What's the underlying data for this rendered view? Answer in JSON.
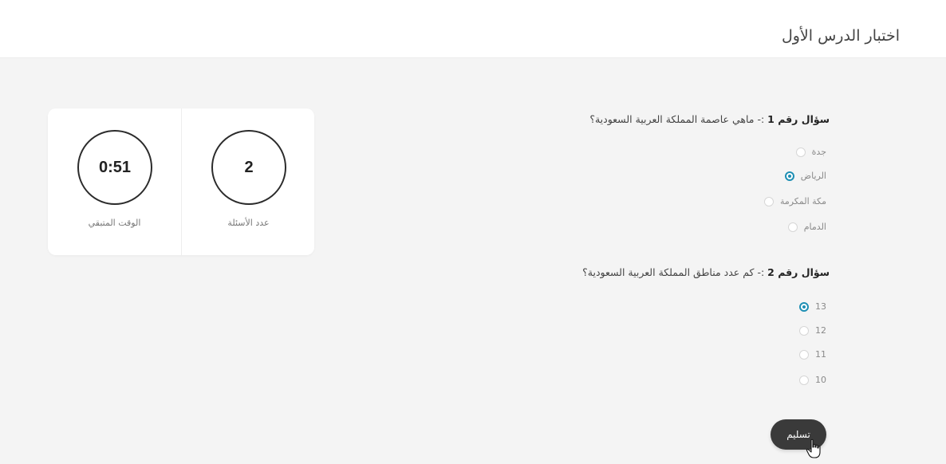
{
  "header": {
    "title": "اختبار الدرس الأول"
  },
  "stats": {
    "question_count": {
      "value": "2",
      "label": "عدد الأسئلة"
    },
    "time_remaining": {
      "value": "0:51",
      "label": "الوقت المتبقي"
    }
  },
  "questions": [
    {
      "number_label": "سؤال رقم 1",
      "text": " :- ماهي عاصمة المملكة العربية السعودية؟",
      "options": [
        {
          "label": "جدة",
          "selected": false
        },
        {
          "label": "الرياض",
          "selected": true
        },
        {
          "label": "مكة المكرمة",
          "selected": false
        },
        {
          "label": "الدمام",
          "selected": false
        }
      ]
    },
    {
      "number_label": "سؤال رقم 2",
      "text": " :- كم عدد مناطق المملكة العربية السعودية؟",
      "options": [
        {
          "label": "13",
          "selected": true
        },
        {
          "label": "12",
          "selected": false
        },
        {
          "label": "11",
          "selected": false
        },
        {
          "label": "10",
          "selected": false
        }
      ]
    }
  ],
  "submit": {
    "label": "تسليم"
  },
  "colors": {
    "accent": "#1e8fb4",
    "button": "#3a3a3a",
    "background": "#f4f4f4"
  },
  "icons": {
    "cursor": "hand-pointer-icon"
  }
}
